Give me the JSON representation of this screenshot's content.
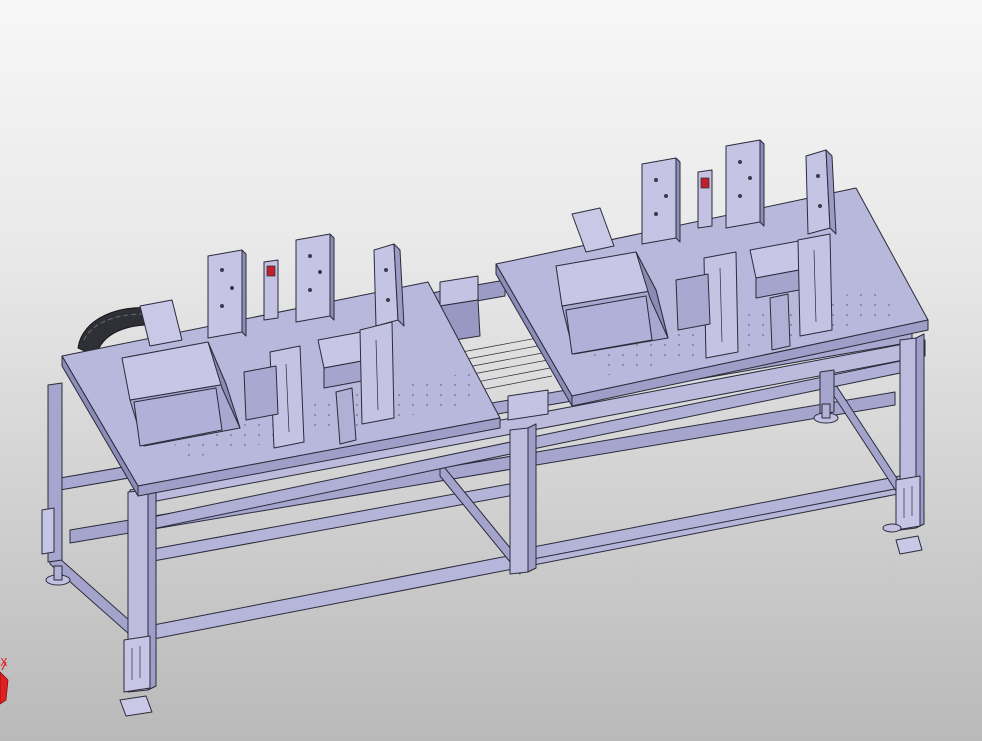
{
  "viewport": {
    "background_top": "#f7f7f7",
    "background_bottom": "#b9b9b9"
  },
  "model": {
    "part_color": "#b3b2d6",
    "part_light": "#c9c8e6",
    "part_dark": "#8e8db8",
    "edge_color": "#2b2b3a",
    "sensor_color": "#c0202a"
  },
  "triad": {
    "x_label": "X",
    "color": "#e02020"
  }
}
